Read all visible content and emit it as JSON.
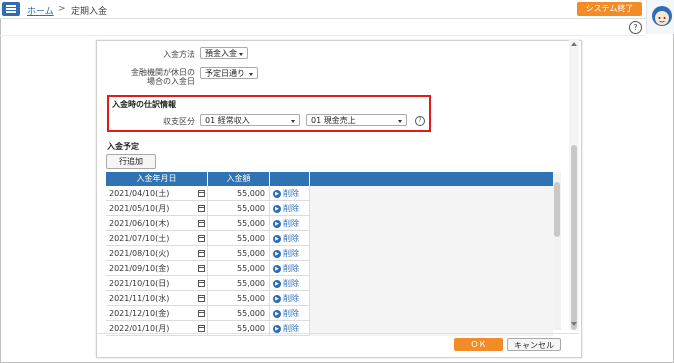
{
  "header": {
    "breadcrumb_home": "ホーム",
    "breadcrumb_separator": ">",
    "breadcrumb_current": "定期入金",
    "system_exit_label": "システム終了",
    "help_label": "?"
  },
  "form": {
    "payment_method_label": "入金方法",
    "payment_method_value": "預金入金",
    "holiday_label_line1": "金融機関が休日の",
    "holiday_label_line2": "場合の入金日",
    "holiday_value": "予定日通り"
  },
  "journal": {
    "section_title": "入金時の仕訳情報",
    "category_label": "収支区分",
    "category_primary": "01 経常収入",
    "category_secondary": "01 現金売上",
    "help_label": "?"
  },
  "schedule": {
    "section_title": "入金予定",
    "add_row_label": "行追加",
    "columns": [
      "入金年月日",
      "入金額"
    ],
    "delete_label": "削除",
    "rows": [
      {
        "date": "2021/04/10(土)",
        "amount": "55,000"
      },
      {
        "date": "2021/05/10(月)",
        "amount": "55,000"
      },
      {
        "date": "2021/06/10(木)",
        "amount": "55,000"
      },
      {
        "date": "2021/07/10(土)",
        "amount": "55,000"
      },
      {
        "date": "2021/08/10(火)",
        "amount": "55,000"
      },
      {
        "date": "2021/09/10(金)",
        "amount": "55,000"
      },
      {
        "date": "2021/10/10(日)",
        "amount": "55,000"
      },
      {
        "date": "2021/11/10(水)",
        "amount": "55,000"
      },
      {
        "date": "2021/12/10(金)",
        "amount": "55,000"
      },
      {
        "date": "2022/01/10(月)",
        "amount": "55,000"
      }
    ]
  },
  "footer": {
    "ok_label": "ＯＫ",
    "cancel_label": "キャンセル"
  },
  "colors": {
    "accent": "#2e6db4",
    "orange": "#f28c28",
    "highlight": "#e01b1b"
  },
  "icons": {
    "menu": "hamburger-icon",
    "avatar": "assistant-avatar-icon",
    "calendar": "calendar-icon",
    "delete": "play-circle-icon"
  }
}
